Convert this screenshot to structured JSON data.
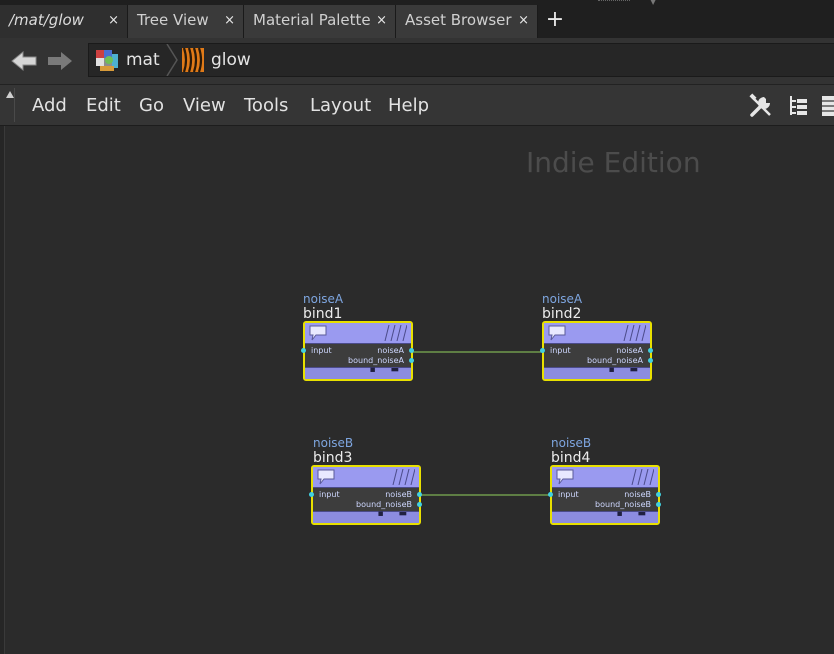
{
  "tabs": [
    {
      "label": "/mat/glow",
      "close": "×"
    },
    {
      "label": "Tree View",
      "close": "×"
    },
    {
      "label": "Material Palette",
      "close": "×"
    },
    {
      "label": "Asset Browser",
      "close": "×"
    }
  ],
  "add_tab_label": "+",
  "path": {
    "crumbs": [
      {
        "label": "mat",
        "icon": "material-network-icon"
      },
      {
        "label": "glow",
        "icon": "material-builder-icon"
      }
    ]
  },
  "menu": [
    "Add",
    "Edit",
    "Go",
    "View",
    "Tools",
    "Layout",
    "Help"
  ],
  "toolbar_icons": [
    "wrench-icon",
    "tree-list-icon",
    "parameters-icon"
  ],
  "watermark": "Indie Edition",
  "nodes": [
    {
      "material": "noiseA",
      "name": "bind1",
      "input": "input",
      "out1": "noiseA",
      "out2": "bound_noiseA"
    },
    {
      "material": "noiseA",
      "name": "bind2",
      "input": "input",
      "out1": "noiseA",
      "out2": "bound_noiseA"
    },
    {
      "material": "noiseB",
      "name": "bind3",
      "input": "input",
      "out1": "noiseB",
      "out2": "bound_noiseB"
    },
    {
      "material": "noiseB",
      "name": "bind4",
      "input": "input",
      "out1": "noiseB",
      "out2": "bound_noiseB"
    }
  ],
  "colors": {
    "node_body": "#8f8fe6",
    "node_selected_border": "#e8e000",
    "wire": "#6f9a4c",
    "port": "#41d0e0",
    "background": "#2b2b2b"
  }
}
